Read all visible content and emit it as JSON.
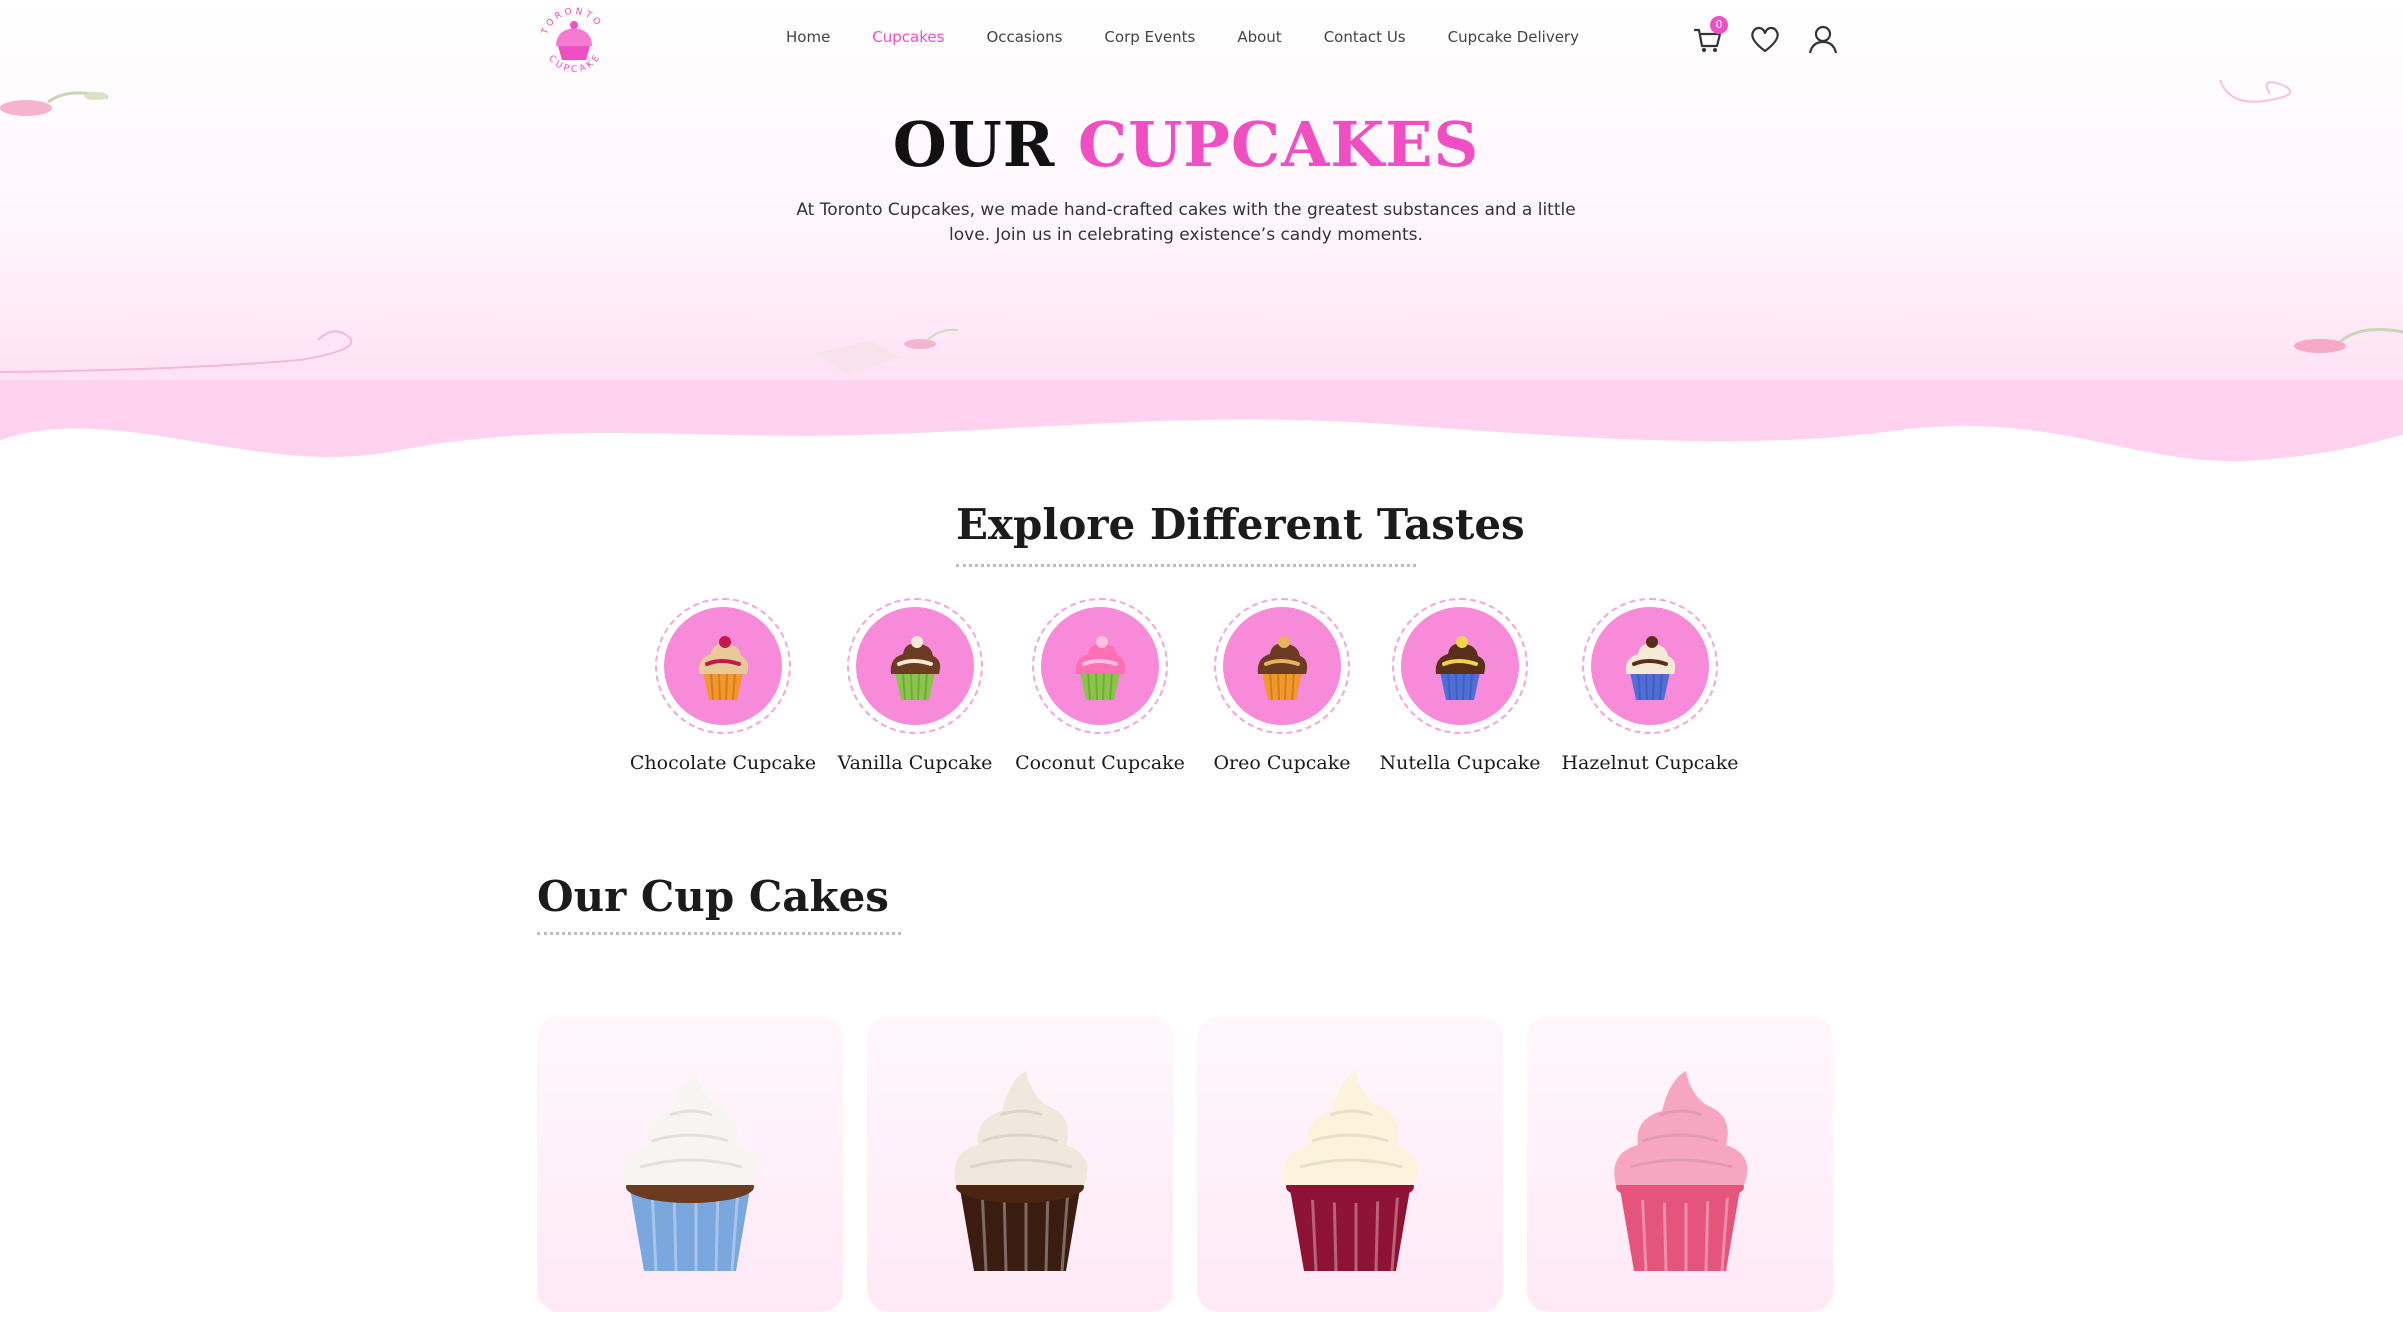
{
  "header": {
    "logo_top_text": "TORONTO",
    "logo_bottom_text": "CUPCAKE",
    "nav": [
      {
        "label": "Home",
        "active": false
      },
      {
        "label": "Cupcakes",
        "active": true
      },
      {
        "label": "Occasions",
        "active": false
      },
      {
        "label": "Corp Events",
        "active": false
      },
      {
        "label": "About",
        "active": false
      },
      {
        "label": "Contact Us",
        "active": false
      },
      {
        "label": "Cupcake Delivery",
        "active": false
      }
    ],
    "cart_count": "0",
    "icons": [
      "cart-icon",
      "heart-icon",
      "user-icon"
    ]
  },
  "hero": {
    "title_dark": "OUR",
    "title_pink": "CUPCAKES",
    "description": "At Toronto Cupcakes, we made hand-crafted cakes with the greatest substances and a little love. Join us in celebrating existence’s candy moments."
  },
  "explore": {
    "title": "Explore Different Tastes",
    "tastes": [
      {
        "label": "Chocolate Cupcake",
        "frosting": "#e8c99a",
        "liner": "#f4962a",
        "topping": "#c4174f"
      },
      {
        "label": "Vanilla Cupcake",
        "frosting": "#6b3b22",
        "liner": "#8ac54a",
        "topping": "#f4ead5"
      },
      {
        "label": "Coconut Cupcake",
        "frosting": "#ff6fb3",
        "liner": "#8ac54a",
        "topping": "#ffc1dd"
      },
      {
        "label": "Oreo Cupcake",
        "frosting": "#6b3b22",
        "liner": "#f4962a",
        "topping": "#e8b15a"
      },
      {
        "label": "Nutella Cupcake",
        "frosting": "#5a2f1a",
        "liner": "#4f6fd8",
        "topping": "#f2d34d"
      },
      {
        "label": "Hazelnut Cupcake",
        "frosting": "#f4ead5",
        "liner": "#4f6fd8",
        "topping": "#5a2f1a"
      }
    ]
  },
  "products": {
    "title": "Our Cup Cakes",
    "cards": [
      {
        "name": "white-frosting-cupcake",
        "frosting": "#f7f5f2",
        "liner": "#7aa7de",
        "base": "#6a3b1e"
      },
      {
        "name": "oreo-chocolate-cupcake",
        "frosting": "#f1e8dd",
        "liner": "#3a1d10",
        "base": "#4b2513"
      },
      {
        "name": "red-velvet-cupcake",
        "frosting": "#fbf3dc",
        "liner": "#8e1233",
        "base": "#8e1233"
      },
      {
        "name": "pink-cherry-cupcake",
        "frosting": "#f7a6c2",
        "liner": "#e4547b",
        "base": "#e4547b"
      }
    ]
  },
  "colors": {
    "accent": "#f04fc4",
    "taste_circle": "#f78ad9"
  }
}
